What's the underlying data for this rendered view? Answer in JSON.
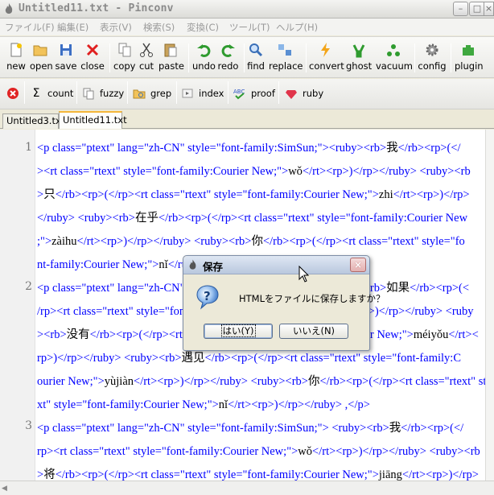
{
  "window": {
    "title": "Untitled11.txt - Pinconv",
    "minimize_glyph": "–",
    "maximize_glyph": "□",
    "close_glyph": "×"
  },
  "menu": [
    "ファイル(F)",
    "編集(E)",
    "表示(V)",
    "検索(S)",
    "変換(C)",
    "ツール(T)",
    "ヘルプ(H)"
  ],
  "toolbar": [
    {
      "label": "new",
      "icon": "new-file-icon"
    },
    {
      "label": "open",
      "icon": "open-folder-icon"
    },
    {
      "label": "save",
      "icon": "save-disk-icon"
    },
    {
      "label": "close",
      "icon": "close-x-icon"
    },
    {
      "label": "copy",
      "icon": "copy-icon"
    },
    {
      "label": "cut",
      "icon": "cut-icon"
    },
    {
      "label": "paste",
      "icon": "paste-icon"
    },
    {
      "label": "undo",
      "icon": "undo-icon"
    },
    {
      "label": "redo",
      "icon": "redo-icon"
    },
    {
      "label": "find",
      "icon": "find-icon"
    },
    {
      "label": "replace",
      "icon": "replace-icon"
    },
    {
      "label": "convert",
      "icon": "convert-icon"
    },
    {
      "label": "ghost",
      "icon": "ghost-icon"
    },
    {
      "label": "vacuum",
      "icon": "vacuum-icon"
    },
    {
      "label": "config",
      "icon": "config-gear-icon"
    },
    {
      "label": "plugin",
      "icon": "plugin-icon"
    }
  ],
  "toolbar2": [
    {
      "label": "",
      "icon": "stop-icon"
    },
    {
      "label": "count",
      "icon": "sigma-icon"
    },
    {
      "label": "fuzzy",
      "icon": "fuzzy-icon"
    },
    {
      "label": "grep",
      "icon": "grep-folder-icon"
    },
    {
      "label": "index",
      "icon": "index-icon"
    },
    {
      "label": "proof",
      "icon": "proof-abc-icon"
    },
    {
      "label": "ruby",
      "icon": "ruby-gem-icon"
    }
  ],
  "tabs": [
    {
      "label": "Untitled3.txt",
      "active": false
    },
    {
      "label": "Untitled11.txt",
      "active": true
    }
  ],
  "editor": {
    "line_numbers": [
      "1",
      "2",
      "3"
    ],
    "visual_lines": [
      "<p class=\"ptext\" lang=\"zh-CN\" style=\"font-family:SimSun;\"><ruby><rb>我</rb><rp>(</",
      "><rt class=\"rtext\" style=\"font-family:Courier New;\">wǒ</rt><rp>)</rp></ruby> <ruby><rb",
      ">只</rb><rp>(</rp><rt class=\"rtext\" style=\"font-family:Courier New;\">zhi</rt><rp>)</rp>",
      "</ruby> <ruby><rb>在乎</rb><rp>(</rp><rt class=\"rtext\" style=\"font-family:Courier New",
      ";\">zàihu</rt><rp>)</rp></ruby> <ruby><rb>你</rb><rp>(</rp><rt class=\"rtext\" style=\"fo",
      "nt-family:Courier New;\">nǐ</rt><rp>)</rp></ruby> 。</p>",
      "<p class=\"ptext\" lang=\"zh-CN\" style=\"font-family:SimSun;\"><ruby><rb>如果</rb><rp>(<",
      "/rp><rt class=\"rtext\" style=\"font-family:Courier New;\">rúguǒ</rt><rp>)</rp></ruby> <ruby",
      "><rb>没有</rb><rp>(</rp><rt class=\"rtext\" style=\"font-family:Courier New;\">méiyǒu</rt><",
      "rp>)</rp></ruby> <ruby><rb>遇见</rb><rp>(</rp><rt class=\"rtext\" style=\"font-family:C",
      "ourier New;\">yùjiàn</rt><rp>)</rp></ruby> <ruby><rb>你</rb><rp>(</rp><rt class=\"rtext\" style",
      "xt\" style=\"font-family:Courier New;\">nǐ</rt><rp>)</rp></ruby> ,</p>",
      "<p class=\"ptext\" lang=\"zh-CN\" style=\"font-family:SimSun;\"> <ruby><rb>我</rb><rp>(</",
      "rp><rt class=\"rtext\" style=\"font-family:Courier New;\">wǒ</rt><rp>)</rp></ruby> <ruby><rb",
      ">将</rb><rp>(</rp><rt class=\"rtext\" style=\"font-family:Courier New;\">jiāng</rt><rp>)</rp>"
    ]
  },
  "dialog": {
    "title": "保存",
    "message": "HTMLをファイルに保存しますか？",
    "yes_label": "はい(Y)",
    "no_label": "いいえ(N)",
    "icon": "question-icon"
  },
  "colors": {
    "markup_text": "#0000ff",
    "tab_accent": "#f4b73b",
    "dialog_border": "#7e8da6"
  }
}
